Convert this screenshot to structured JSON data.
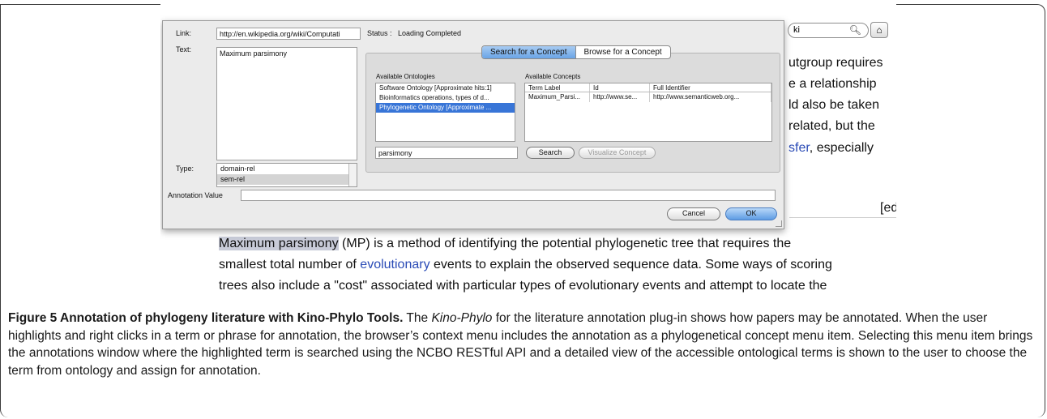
{
  "dialog": {
    "link_label": "Link:",
    "link_value": "http://en.wikipedia.org/wiki/Computati",
    "status_label": "Status :",
    "status_value": "Loading Completed",
    "text_label": "Text:",
    "text_value": "Maximum parsimony",
    "tabs": [
      {
        "label": "Search for a Concept",
        "active": true
      },
      {
        "label": "Browse for a Concept",
        "active": false
      }
    ],
    "ontologies_label": "Available Ontologies",
    "ontologies": [
      {
        "label": "Software Ontology [Approximate hits:1]",
        "selected": false
      },
      {
        "label": "Bioinformatics operations, types of d...",
        "selected": false
      },
      {
        "label": "Phylogenetic Ontology [Approximate ...",
        "selected": true
      }
    ],
    "concepts_label": "Available Concepts",
    "concept_columns": [
      "Term Label",
      "Id",
      "Full Identifier"
    ],
    "concept_rows": [
      [
        "Maximum_Parsi...",
        "http://www.se...",
        "http://www.semanticweb.org..."
      ]
    ],
    "search_value": "parsimony",
    "search_button": "Search",
    "visualize_button": "Visualize Concept",
    "type_label": "Type:",
    "types": [
      {
        "label": "domain-rel",
        "selected": false
      },
      {
        "label": "sem-rel",
        "selected": true
      }
    ],
    "annotation_label": "Annotation Value",
    "cancel_button": "Cancel",
    "ok_button": "OK"
  },
  "browser": {
    "search_text": "ki",
    "right_lines": [
      "utgroup requires",
      "e a relationship",
      "ld also be taken",
      "related, but the"
    ],
    "right_link": "sfer",
    "right_link_tail": ", especially",
    "edit_link": "[edit]",
    "para_highlight": "Maximum parsimony",
    "para_line1_rest": " (MP) is a method of identifying the potential phylogenetic tree that requires the",
    "para_line2_pre": "smallest total number of ",
    "para_line2_link": "evolutionary",
    "para_line2_post": " events to explain the observed sequence data. Some ways of scoring",
    "para_line3": "trees also include a \"cost\" associated with particular types of evolutionary events and attempt to locate the"
  },
  "caption": {
    "title": "Figure 5 Annotation of phylogeny literature with Kino-Phylo Tools",
    "title_end": ".",
    "p1": " The ",
    "italic": "Kino-Phylo",
    "p2": " for the literature annotation plug-in shows how papers may be annotated. When the user highlights and right clicks in a term or phrase for annotation, the browser’s context menu includes the annotation as a phylogenetical concept menu item. Selecting this menu item brings the annotations window where the highlighted term is searched using the NCBO RESTful API and a detailed view of the accessible ontological terms is shown to the user to choose the term from ontology and assign for annotation."
  }
}
